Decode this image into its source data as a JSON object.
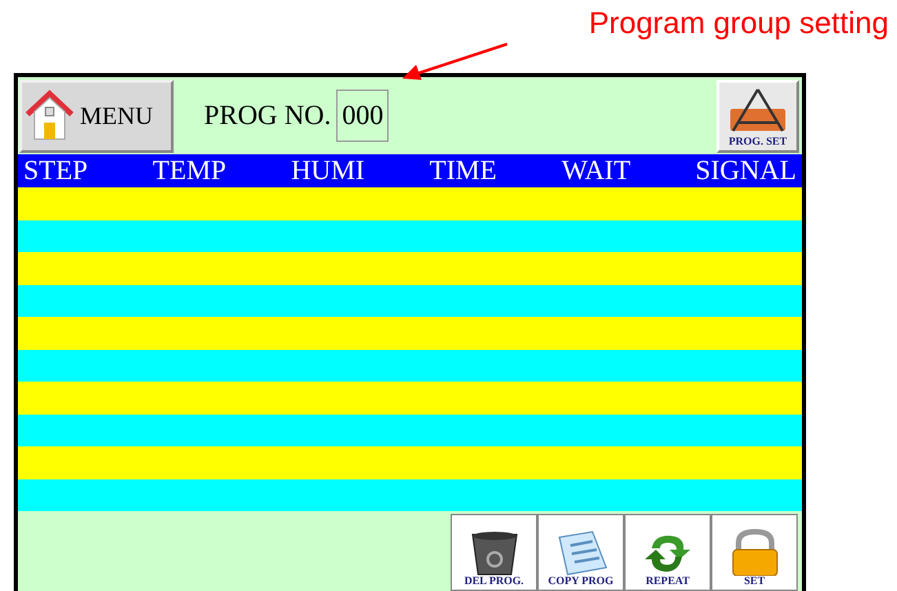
{
  "annotation": {
    "text": "Program group setting"
  },
  "top_bar": {
    "menu_button": "MENU",
    "prog_no_label": "PROG NO.",
    "prog_no_value": "000",
    "prog_set_button": "PROG. SET"
  },
  "table": {
    "columns": [
      "STEP",
      "TEMP",
      "HUMI",
      "TIME",
      "WAIT",
      "SIGNAL"
    ],
    "rows": [
      {
        "color": "#ffff00"
      },
      {
        "color": "#00ffff"
      },
      {
        "color": "#ffff00"
      },
      {
        "color": "#00ffff"
      },
      {
        "color": "#ffff00"
      },
      {
        "color": "#00ffff"
      },
      {
        "color": "#ffff00"
      },
      {
        "color": "#00ffff"
      },
      {
        "color": "#ffff00"
      },
      {
        "color": "#00ffff"
      }
    ]
  },
  "bottom_buttons": [
    {
      "kind": "delete",
      "label": "DEL PROG."
    },
    {
      "kind": "copy",
      "label": "COPY PROG"
    },
    {
      "kind": "repeat",
      "label": "REPEAT"
    },
    {
      "kind": "set",
      "label": "SET"
    }
  ]
}
